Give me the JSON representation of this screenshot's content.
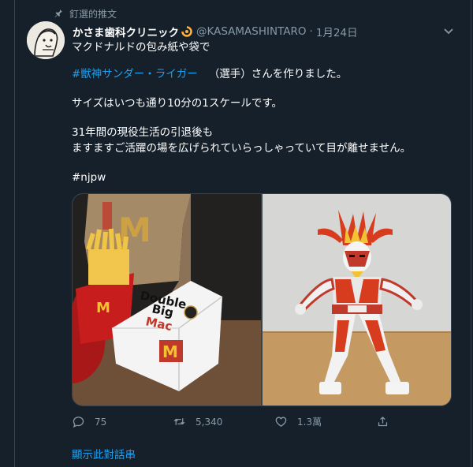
{
  "pinned": {
    "label": "釘選的推文",
    "icon": "pin-icon"
  },
  "tweet": {
    "display_name": "かさま歯科クリニック",
    "handle": "@KASAMASHINTARO",
    "separator": "·",
    "date": "1月24日",
    "lines": {
      "l1": "マクドナルドの包み紙や袋で",
      "l2_hashtag": "#獣神サンダー・ライガー",
      "l2_rest": "（選手）さんを作りました。",
      "l3": "サイズはいつも通り10分の1スケールです。",
      "l4": "31年間の現役生活の引退後も",
      "l5": "ますますご活躍の場を広げられていらっしゃっていて目が離せません。",
      "l6_hashtag": "#njpw"
    },
    "media": {
      "left_box_text_1": "Double",
      "left_box_text_2": "Big",
      "left_box_text_3": "Mac"
    }
  },
  "actions": {
    "reply_count": "75",
    "retweet_count": "5,340",
    "like_count": "1.3萬"
  },
  "show_thread": "顯示此對話串",
  "colors": {
    "background": "#15202b",
    "accent": "#1da1f2",
    "secondary_text": "#8899a6",
    "border": "#38444d"
  }
}
